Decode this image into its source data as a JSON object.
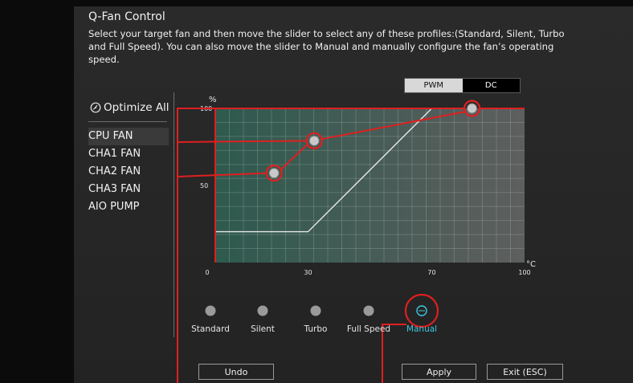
{
  "header": {
    "title": "Q-Fan Control",
    "description": "Select your target fan and then move the slider to select any of these profiles:(Standard, Silent, Turbo and Full Speed). You can also move the slider to Manual and manually configure the fan’s operating speed."
  },
  "sidebar": {
    "optimize_all": "Optimize All",
    "fans": [
      {
        "label": "CPU FAN",
        "selected": true
      },
      {
        "label": "CHA1 FAN",
        "selected": false
      },
      {
        "label": "CHA2 FAN",
        "selected": false
      },
      {
        "label": "CHA3 FAN",
        "selected": false
      },
      {
        "label": "AIO PUMP",
        "selected": false
      }
    ]
  },
  "mode_toggle": {
    "options": [
      "PWM",
      "DC"
    ],
    "active": "PWM"
  },
  "chart_data": {
    "type": "line",
    "ylabel": "%",
    "xlabel": "°C",
    "xlim": [
      0,
      100
    ],
    "ylim": [
      0,
      100
    ],
    "x_ticks": [
      "0",
      "30",
      "70",
      "100"
    ],
    "y_ticks": [
      "100",
      "50"
    ],
    "grid": true,
    "curve": [
      {
        "x": 0,
        "y": 20
      },
      {
        "x": 30,
        "y": 20
      },
      {
        "x": 70,
        "y": 100
      }
    ],
    "control_points": [
      {
        "x": 19,
        "y": 58
      },
      {
        "x": 32,
        "y": 79
      },
      {
        "x": 83,
        "y": 100
      }
    ]
  },
  "profiles": {
    "items": [
      "Standard",
      "Silent",
      "Turbo",
      "Full Speed",
      "Manual"
    ],
    "active_index": 4
  },
  "buttons": {
    "undo": "Undo",
    "apply": "Apply",
    "exit": "Exit (ESC)"
  },
  "colors": {
    "highlight": "#e01f1f",
    "active": "#3fc7e0",
    "plot_left": "#2e5a4e",
    "plot_right": "#5e5e5e"
  }
}
